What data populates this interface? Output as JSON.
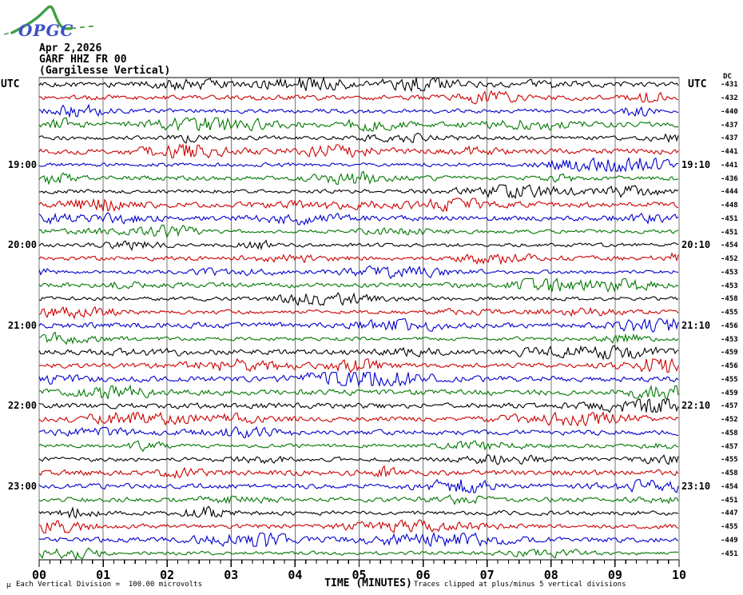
{
  "logo": {
    "text": "OPGC"
  },
  "title": {
    "date": "Apr 2,2026",
    "station": "GARF HHZ FR 00",
    "subtitle": "(Gargilesse Vertical)"
  },
  "left_axis": {
    "header": "UTC",
    "labels": [
      {
        "row": 7,
        "text": "19:00"
      },
      {
        "row": 13,
        "text": "20:00"
      },
      {
        "row": 19,
        "text": "21:00"
      },
      {
        "row": 25,
        "text": "22:00"
      },
      {
        "row": 31,
        "text": "23:00"
      }
    ]
  },
  "right_axis": {
    "header": "UTC",
    "dc_header": "DC",
    "labels": [
      {
        "row": 7,
        "text": "19:10"
      },
      {
        "row": 13,
        "text": "20:10"
      },
      {
        "row": 19,
        "text": "21:10"
      },
      {
        "row": 25,
        "text": "22:10"
      },
      {
        "row": 31,
        "text": "23:10"
      }
    ]
  },
  "x_axis": {
    "title": "TIME (MINUTES)",
    "tick_labels": [
      "00",
      "01",
      "02",
      "03",
      "04",
      "05",
      "06",
      "07",
      "08",
      "09",
      "10"
    ]
  },
  "footer": {
    "mu": "µ",
    "division_note": "Each Vertical Division =  100.00 microvolts",
    "clip_note": "Traces clipped at plus/minus 5 vertical divisions"
  },
  "chart_data": {
    "type": "line",
    "subtype": "helicorder-seismogram",
    "title": "GARF HHZ FR 00 (Gargilesse Vertical)",
    "date": "Apr 2,2026",
    "xlabel": "TIME (MINUTES)",
    "x_range_minutes": [
      0,
      10
    ],
    "minutes_per_row": 10,
    "rows": 36,
    "minor_ticks_per_minute": 6,
    "row_color_cycle": [
      "#000000",
      "#cc0000",
      "#0000cc",
      "#007700"
    ],
    "hour_label_rows": [
      7,
      13,
      19,
      25,
      31
    ],
    "dc_values": [
      -431,
      -432,
      -440,
      -437,
      -437,
      -441,
      -441,
      -436,
      -444,
      -448,
      -451,
      -451,
      -454,
      -452,
      -453,
      -453,
      -458,
      -455,
      -456,
      -453,
      -459,
      -456,
      -455,
      -459,
      -457,
      -452,
      -458,
      -457,
      -455,
      -458,
      -454,
      -451,
      -447,
      -455,
      -449,
      -451
    ],
    "clip_note": "Traces clipped at plus/minus 5 vertical divisions",
    "vertical_division_microvolts": 100.0,
    "noise_seed": 20260402
  },
  "colors": {
    "background": "#ffffff",
    "grid": "#787878",
    "axis": "#000000",
    "text": "#000000",
    "logo_blue": "#3c50c8",
    "logo_green": "#3f9f46"
  }
}
